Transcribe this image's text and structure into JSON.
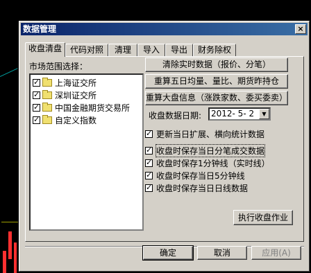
{
  "dialog": {
    "title": "数据管理",
    "close_glyph": "×"
  },
  "tabs": [
    "收盘清盘",
    "代码对照",
    "清理",
    "导入",
    "导出",
    "财务除权"
  ],
  "left": {
    "label": "市场范围选择：",
    "markets": [
      "上海证交所",
      "深圳证交所",
      "中国金融期货交易所",
      "自定义指数"
    ]
  },
  "right": {
    "btn_clear_realtime": "清除实时数据（报价、分笔）",
    "btn_recalc_5day": "重算五日均量、量比、期货昨持仓",
    "btn_recalc_market": "重算大盘信息（涨跌家数、委买委卖）",
    "date_label": "收盘数据日期:",
    "date_value": "2012- 5- 2",
    "check_update": "更新当日扩展、横向统计数据",
    "check_ticks": "收盘时保存当日分笔成交数据",
    "check_1min": "收盘时保存1分钟线（实时线）",
    "check_5min": "收盘时保存当日5分钟线",
    "check_daily": "收盘时保存当日日线数据",
    "btn_execute": "执行收盘作业"
  },
  "footer": {
    "ok": "确定",
    "cancel": "取消",
    "apply": "应用(A)"
  },
  "check_glyph": "✓",
  "dropdown_glyph": "▼"
}
